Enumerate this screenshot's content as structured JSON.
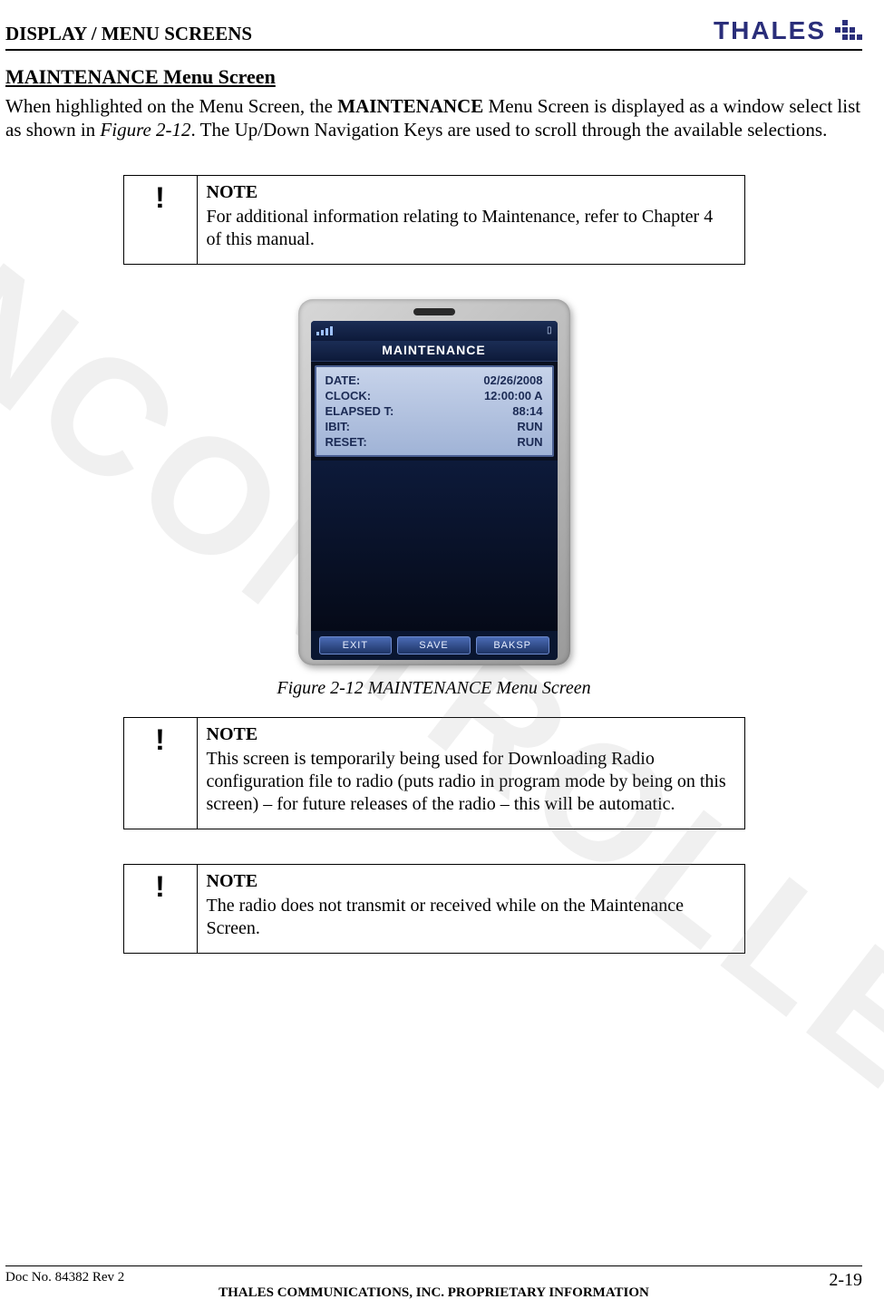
{
  "header": {
    "section": "DISPLAY / MENU SCREENS",
    "brand": "THALES"
  },
  "section_title": "MAINTENANCE Menu Screen",
  "body": {
    "p1_a": "When highlighted on the Menu Screen, the ",
    "p1_b": "MAINTENANCE",
    "p1_c": " Menu Screen is displayed as a window select list as shown in ",
    "p1_d": "Figure 2-12",
    "p1_e": ".   The Up/Down Navigation Keys are used to scroll through the available selections."
  },
  "notes": [
    {
      "icon": "!",
      "heading": "NOTE",
      "text": "For additional information relating to Maintenance, refer to Chapter 4 of this manual."
    },
    {
      "icon": "!",
      "heading": "NOTE",
      "text": "This screen is temporarily being used for Downloading Radio configuration file to radio (puts radio in program mode by being on this screen) – for future releases of the radio – this will be automatic."
    },
    {
      "icon": "!",
      "heading": "NOTE",
      "text": "The radio does not transmit or received while on the Maintenance Screen."
    }
  ],
  "figure": {
    "caption": "Figure 2-12 MAINTENANCE Menu Screen",
    "screen_title": "MAINTENANCE",
    "rows": [
      {
        "label": "DATE:",
        "value": "02/26/2008"
      },
      {
        "label": "CLOCK:",
        "value": "12:00:00 A"
      },
      {
        "label": "ELAPSED T:",
        "value": "88:14"
      },
      {
        "label": "IBIT:",
        "value": "RUN"
      },
      {
        "label": "RESET:",
        "value": "RUN"
      }
    ],
    "softkeys": [
      "EXIT",
      "SAVE",
      "BAKSP"
    ],
    "status_battery": "▯"
  },
  "footer": {
    "doc": "Doc No. 84382 Rev 2",
    "center": "THALES COMMUNICATIONS, INC. PROPRIETARY INFORMATION",
    "page": "2-19"
  },
  "watermark": "UNCONTROLLED"
}
